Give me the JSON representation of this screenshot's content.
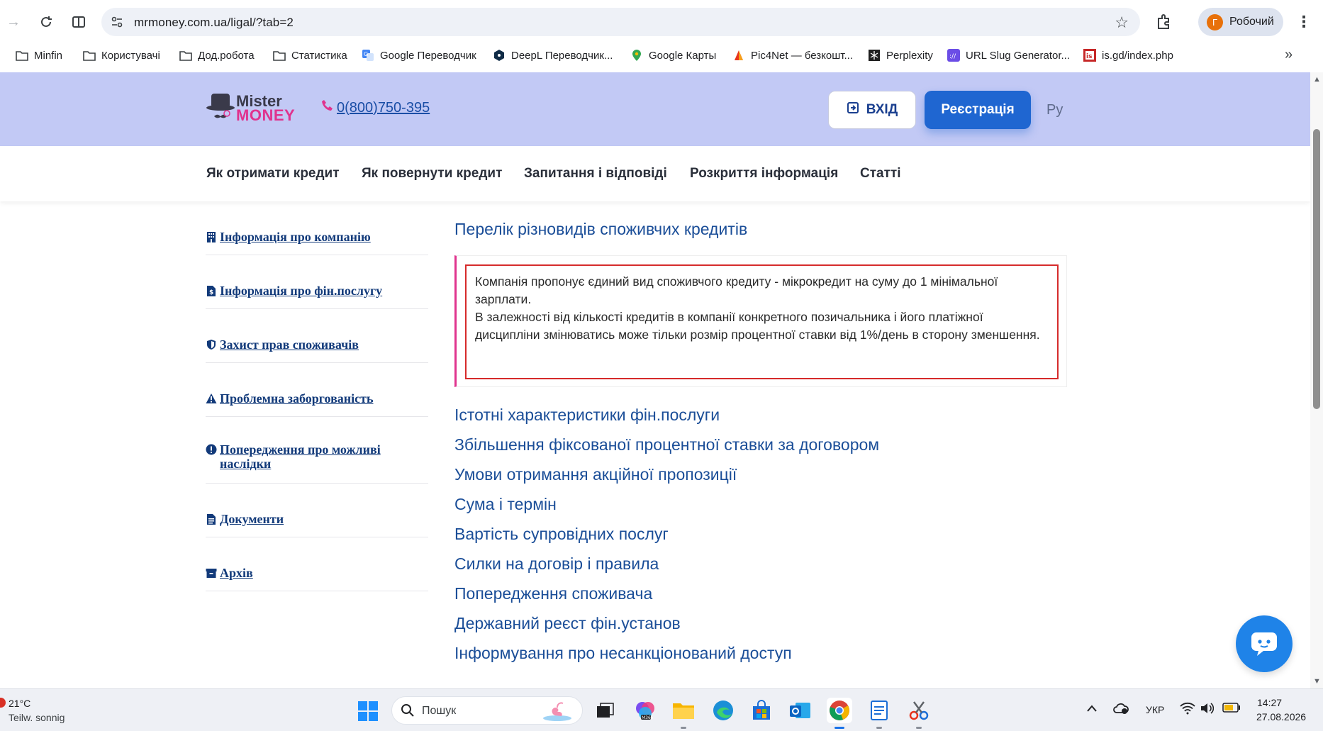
{
  "browser": {
    "url": "mrmoney.com.ua/ligal/?tab=2",
    "profile_initial": "Г",
    "profile_name": "Робочий",
    "bookmarks": [
      {
        "label": "Minfin",
        "icon": "folder-icon"
      },
      {
        "label": "Користувачі",
        "icon": "folder-icon"
      },
      {
        "label": "Дод.робота",
        "icon": "folder-icon"
      },
      {
        "label": "Статистика",
        "icon": "folder-icon"
      },
      {
        "label": "Google Переводчик",
        "icon": "google-translate-icon"
      },
      {
        "label": "DeepL Переводчик...",
        "icon": "deepl-icon"
      },
      {
        "label": "Google Карты",
        "icon": "google-maps-icon"
      },
      {
        "label": "Pic4Net — безкошт...",
        "icon": "pic4net-icon"
      },
      {
        "label": "Perplexity",
        "icon": "perplexity-icon"
      },
      {
        "label": "URL Slug Generator...",
        "icon": "url-slug-icon"
      },
      {
        "label": "is.gd/index.php",
        "icon": "isgd-icon"
      }
    ]
  },
  "header": {
    "logo_line1": "Mister",
    "logo_line2": "MONEY",
    "phone": "0(800)750-395",
    "login_label": "ВХІД",
    "register_label": "Реєстрація",
    "lang_label": "Ру"
  },
  "nav": [
    "Як отримати кредит",
    "Як повернути кредит",
    "Запитання і відповіді",
    "Розкриття інформація",
    "Статті"
  ],
  "sidebar": [
    {
      "label": "Інформація про компанію",
      "icon": "building-icon"
    },
    {
      "label": "Інформація про фін.послугу",
      "icon": "money-file-icon"
    },
    {
      "label": "Захист прав споживачів",
      "icon": "shield-icon"
    },
    {
      "label": "Проблемна заборгованість",
      "icon": "warning-icon"
    },
    {
      "label": " Попередження про можливі наслідки",
      "icon": "exclamation-icon"
    },
    {
      "label": "Документи",
      "icon": "document-icon"
    },
    {
      "label": "Архів",
      "icon": "archive-icon"
    }
  ],
  "content": {
    "open_section": "Перелік різновидів споживчих кредитів",
    "info_text_1": "Компанія пропонує єдиний вид споживчого кредиту - мікрокредит на суму до 1 мінімальної зарплати.",
    "info_text_2": "В залежності від кількості кредитів в компанії конкретного позичальника і його платіжної дисципліни змінюватись може тільки розмір процентної ставки від 1%/день в сторону зменшення.",
    "sections": [
      "Істотні характеристики фін.послуги",
      "Збільшення фіксованої процентної ставки за договором",
      "Умови отримання акційної пропозиції",
      "Сума і термін",
      "Вартість супровідних послуг",
      "Силки на договір і правила",
      "Попередження споживача",
      "Державний реєст фін.установ",
      "Інформування про несанкціонований доступ"
    ]
  },
  "taskbar": {
    "temp": "21°C",
    "weather": "Teilw. sonnig",
    "search_placeholder": "Пошук",
    "lang": "УКР",
    "time": "14:27",
    "date": "27.08.2026"
  },
  "colors": {
    "header_bg": "#c2c9f5",
    "brand_blue": "#1f66d1",
    "brand_pink": "#e0338e",
    "link_blue": "#1b4e98",
    "box_border_red": "#d62b2b"
  }
}
